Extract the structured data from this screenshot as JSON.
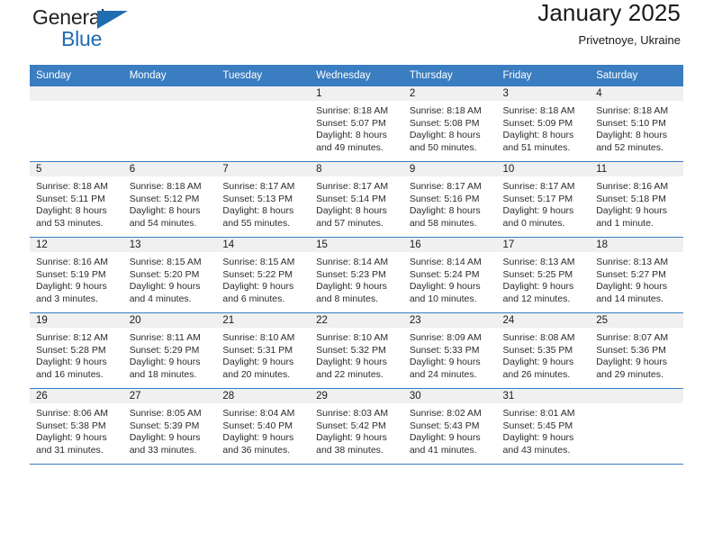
{
  "brand": {
    "line1": "General",
    "line2": "Blue",
    "triangle_icon": "brand-triangle-icon"
  },
  "header": {
    "title": "January 2025",
    "subtitle": "Privetnoye, Ukraine"
  },
  "colors": {
    "header_blue": "#3a7dc0",
    "brand_blue": "#1f6cb0",
    "daynum_band": "#f0f0f0",
    "text": "#1a1a1a"
  },
  "weekday_headers": [
    "Sunday",
    "Monday",
    "Tuesday",
    "Wednesday",
    "Thursday",
    "Friday",
    "Saturday"
  ],
  "labels": {
    "sunrise_prefix": "Sunrise:",
    "sunset_prefix": "Sunset:",
    "daylight_prefix": "Daylight:"
  },
  "weeks": [
    [
      {
        "day": "",
        "sunrise": "",
        "sunset": "",
        "daylight_line1": "",
        "daylight_line2": ""
      },
      {
        "day": "",
        "sunrise": "",
        "sunset": "",
        "daylight_line1": "",
        "daylight_line2": ""
      },
      {
        "day": "",
        "sunrise": "",
        "sunset": "",
        "daylight_line1": "",
        "daylight_line2": ""
      },
      {
        "day": "1",
        "sunrise": "Sunrise: 8:18 AM",
        "sunset": "Sunset: 5:07 PM",
        "daylight_line1": "Daylight: 8 hours",
        "daylight_line2": "and 49 minutes."
      },
      {
        "day": "2",
        "sunrise": "Sunrise: 8:18 AM",
        "sunset": "Sunset: 5:08 PM",
        "daylight_line1": "Daylight: 8 hours",
        "daylight_line2": "and 50 minutes."
      },
      {
        "day": "3",
        "sunrise": "Sunrise: 8:18 AM",
        "sunset": "Sunset: 5:09 PM",
        "daylight_line1": "Daylight: 8 hours",
        "daylight_line2": "and 51 minutes."
      },
      {
        "day": "4",
        "sunrise": "Sunrise: 8:18 AM",
        "sunset": "Sunset: 5:10 PM",
        "daylight_line1": "Daylight: 8 hours",
        "daylight_line2": "and 52 minutes."
      }
    ],
    [
      {
        "day": "5",
        "sunrise": "Sunrise: 8:18 AM",
        "sunset": "Sunset: 5:11 PM",
        "daylight_line1": "Daylight: 8 hours",
        "daylight_line2": "and 53 minutes."
      },
      {
        "day": "6",
        "sunrise": "Sunrise: 8:18 AM",
        "sunset": "Sunset: 5:12 PM",
        "daylight_line1": "Daylight: 8 hours",
        "daylight_line2": "and 54 minutes."
      },
      {
        "day": "7",
        "sunrise": "Sunrise: 8:17 AM",
        "sunset": "Sunset: 5:13 PM",
        "daylight_line1": "Daylight: 8 hours",
        "daylight_line2": "and 55 minutes."
      },
      {
        "day": "8",
        "sunrise": "Sunrise: 8:17 AM",
        "sunset": "Sunset: 5:14 PM",
        "daylight_line1": "Daylight: 8 hours",
        "daylight_line2": "and 57 minutes."
      },
      {
        "day": "9",
        "sunrise": "Sunrise: 8:17 AM",
        "sunset": "Sunset: 5:16 PM",
        "daylight_line1": "Daylight: 8 hours",
        "daylight_line2": "and 58 minutes."
      },
      {
        "day": "10",
        "sunrise": "Sunrise: 8:17 AM",
        "sunset": "Sunset: 5:17 PM",
        "daylight_line1": "Daylight: 9 hours",
        "daylight_line2": "and 0 minutes."
      },
      {
        "day": "11",
        "sunrise": "Sunrise: 8:16 AM",
        "sunset": "Sunset: 5:18 PM",
        "daylight_line1": "Daylight: 9 hours",
        "daylight_line2": "and 1 minute."
      }
    ],
    [
      {
        "day": "12",
        "sunrise": "Sunrise: 8:16 AM",
        "sunset": "Sunset: 5:19 PM",
        "daylight_line1": "Daylight: 9 hours",
        "daylight_line2": "and 3 minutes."
      },
      {
        "day": "13",
        "sunrise": "Sunrise: 8:15 AM",
        "sunset": "Sunset: 5:20 PM",
        "daylight_line1": "Daylight: 9 hours",
        "daylight_line2": "and 4 minutes."
      },
      {
        "day": "14",
        "sunrise": "Sunrise: 8:15 AM",
        "sunset": "Sunset: 5:22 PM",
        "daylight_line1": "Daylight: 9 hours",
        "daylight_line2": "and 6 minutes."
      },
      {
        "day": "15",
        "sunrise": "Sunrise: 8:14 AM",
        "sunset": "Sunset: 5:23 PM",
        "daylight_line1": "Daylight: 9 hours",
        "daylight_line2": "and 8 minutes."
      },
      {
        "day": "16",
        "sunrise": "Sunrise: 8:14 AM",
        "sunset": "Sunset: 5:24 PM",
        "daylight_line1": "Daylight: 9 hours",
        "daylight_line2": "and 10 minutes."
      },
      {
        "day": "17",
        "sunrise": "Sunrise: 8:13 AM",
        "sunset": "Sunset: 5:25 PM",
        "daylight_line1": "Daylight: 9 hours",
        "daylight_line2": "and 12 minutes."
      },
      {
        "day": "18",
        "sunrise": "Sunrise: 8:13 AM",
        "sunset": "Sunset: 5:27 PM",
        "daylight_line1": "Daylight: 9 hours",
        "daylight_line2": "and 14 minutes."
      }
    ],
    [
      {
        "day": "19",
        "sunrise": "Sunrise: 8:12 AM",
        "sunset": "Sunset: 5:28 PM",
        "daylight_line1": "Daylight: 9 hours",
        "daylight_line2": "and 16 minutes."
      },
      {
        "day": "20",
        "sunrise": "Sunrise: 8:11 AM",
        "sunset": "Sunset: 5:29 PM",
        "daylight_line1": "Daylight: 9 hours",
        "daylight_line2": "and 18 minutes."
      },
      {
        "day": "21",
        "sunrise": "Sunrise: 8:10 AM",
        "sunset": "Sunset: 5:31 PM",
        "daylight_line1": "Daylight: 9 hours",
        "daylight_line2": "and 20 minutes."
      },
      {
        "day": "22",
        "sunrise": "Sunrise: 8:10 AM",
        "sunset": "Sunset: 5:32 PM",
        "daylight_line1": "Daylight: 9 hours",
        "daylight_line2": "and 22 minutes."
      },
      {
        "day": "23",
        "sunrise": "Sunrise: 8:09 AM",
        "sunset": "Sunset: 5:33 PM",
        "daylight_line1": "Daylight: 9 hours",
        "daylight_line2": "and 24 minutes."
      },
      {
        "day": "24",
        "sunrise": "Sunrise: 8:08 AM",
        "sunset": "Sunset: 5:35 PM",
        "daylight_line1": "Daylight: 9 hours",
        "daylight_line2": "and 26 minutes."
      },
      {
        "day": "25",
        "sunrise": "Sunrise: 8:07 AM",
        "sunset": "Sunset: 5:36 PM",
        "daylight_line1": "Daylight: 9 hours",
        "daylight_line2": "and 29 minutes."
      }
    ],
    [
      {
        "day": "26",
        "sunrise": "Sunrise: 8:06 AM",
        "sunset": "Sunset: 5:38 PM",
        "daylight_line1": "Daylight: 9 hours",
        "daylight_line2": "and 31 minutes."
      },
      {
        "day": "27",
        "sunrise": "Sunrise: 8:05 AM",
        "sunset": "Sunset: 5:39 PM",
        "daylight_line1": "Daylight: 9 hours",
        "daylight_line2": "and 33 minutes."
      },
      {
        "day": "28",
        "sunrise": "Sunrise: 8:04 AM",
        "sunset": "Sunset: 5:40 PM",
        "daylight_line1": "Daylight: 9 hours",
        "daylight_line2": "and 36 minutes."
      },
      {
        "day": "29",
        "sunrise": "Sunrise: 8:03 AM",
        "sunset": "Sunset: 5:42 PM",
        "daylight_line1": "Daylight: 9 hours",
        "daylight_line2": "and 38 minutes."
      },
      {
        "day": "30",
        "sunrise": "Sunrise: 8:02 AM",
        "sunset": "Sunset: 5:43 PM",
        "daylight_line1": "Daylight: 9 hours",
        "daylight_line2": "and 41 minutes."
      },
      {
        "day": "31",
        "sunrise": "Sunrise: 8:01 AM",
        "sunset": "Sunset: 5:45 PM",
        "daylight_line1": "Daylight: 9 hours",
        "daylight_line2": "and 43 minutes."
      },
      {
        "day": "",
        "sunrise": "",
        "sunset": "",
        "daylight_line1": "",
        "daylight_line2": ""
      }
    ]
  ]
}
